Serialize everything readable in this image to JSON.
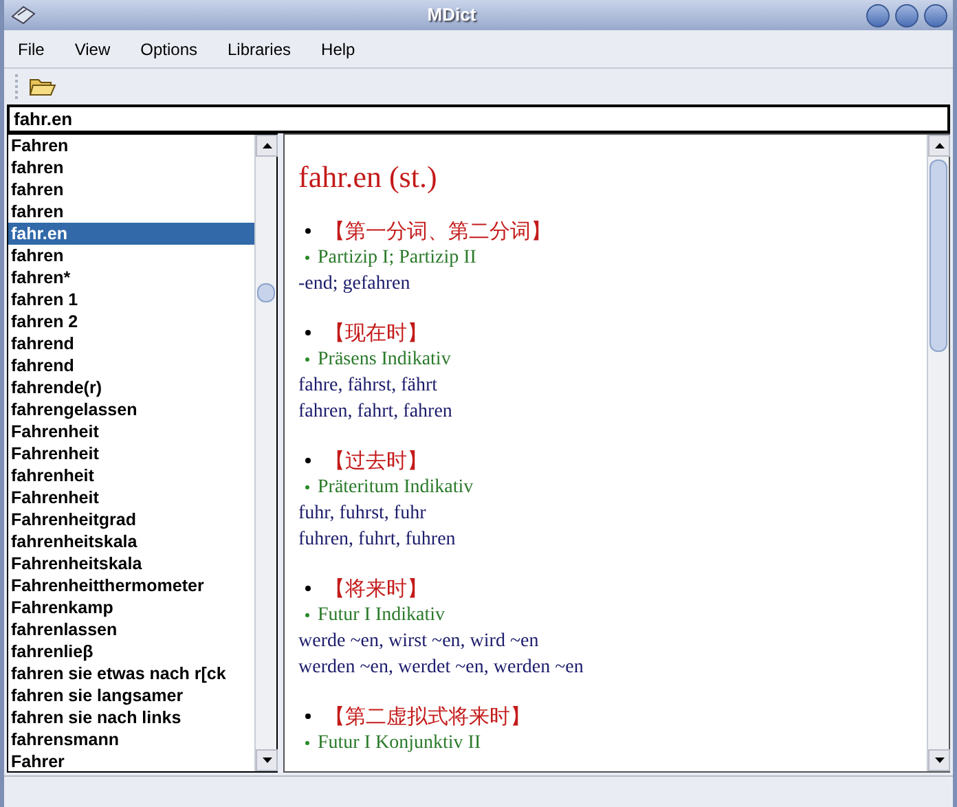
{
  "window": {
    "title": "MDict"
  },
  "menu": [
    "File",
    "View",
    "Options",
    "Libraries",
    "Help"
  ],
  "search": {
    "value": "fahr.en"
  },
  "word_list": [
    {
      "text": "Fahren",
      "selected": false
    },
    {
      "text": "fahren",
      "selected": false
    },
    {
      "text": "fahren",
      "selected": false
    },
    {
      "text": "fahren",
      "selected": false
    },
    {
      "text": "fahr.en",
      "selected": true
    },
    {
      "text": "fahren",
      "selected": false
    },
    {
      "text": "fahren*",
      "selected": false
    },
    {
      "text": "fahren 1",
      "selected": false
    },
    {
      "text": "fahren 2",
      "selected": false
    },
    {
      "text": "fahrend",
      "selected": false
    },
    {
      "text": "fahrend",
      "selected": false
    },
    {
      "text": "fahrende(r)",
      "selected": false
    },
    {
      "text": "fahrengelassen",
      "selected": false
    },
    {
      "text": "Fahrenheit",
      "selected": false
    },
    {
      "text": "Fahrenheit",
      "selected": false
    },
    {
      "text": "fahrenheit",
      "selected": false
    },
    {
      "text": "Fahrenheit",
      "selected": false
    },
    {
      "text": "Fahrenheitgrad",
      "selected": false
    },
    {
      "text": "fahrenheitskala",
      "selected": false
    },
    {
      "text": "Fahrenheitskala",
      "selected": false
    },
    {
      "text": "Fahrenheitthermometer",
      "selected": false
    },
    {
      "text": "Fahrenkamp",
      "selected": false
    },
    {
      "text": "fahrenlassen",
      "selected": false
    },
    {
      "text": "fahrenlieβ",
      "selected": false
    },
    {
      "text": "fahren sie etwas nach r[ck",
      "selected": false
    },
    {
      "text": "fahren sie langsamer",
      "selected": false
    },
    {
      "text": "fahren sie nach links",
      "selected": false
    },
    {
      "text": "fahrensmann",
      "selected": false
    },
    {
      "text": "Fahrer",
      "selected": false
    }
  ],
  "entry": {
    "headword": "fahr.en (st.)",
    "sections": [
      {
        "heading": "【第一分词、第二分词】",
        "subheading": "Partizip I; Partizip II",
        "lines": [
          "-end; gefahren"
        ]
      },
      {
        "heading": "【现在时】",
        "subheading": "Präsens Indikativ",
        "lines": [
          "fahre, fährst, fährt",
          "fahren, fahrt, fahren"
        ]
      },
      {
        "heading": "【过去时】",
        "subheading": "Präteritum Indikativ",
        "lines": [
          "fuhr, fuhrst, fuhr",
          "fuhren, fuhrt, fuhren"
        ]
      },
      {
        "heading": "【将来时】",
        "subheading": "Futur I Indikativ",
        "lines": [
          "werde ~en, wirst ~en, wird ~en",
          "werden ~en, werdet ~en, werden ~en"
        ]
      },
      {
        "heading": "【第二虚拟式将来时】",
        "subheading": "Futur I Konjunktiv II"
      }
    ]
  }
}
